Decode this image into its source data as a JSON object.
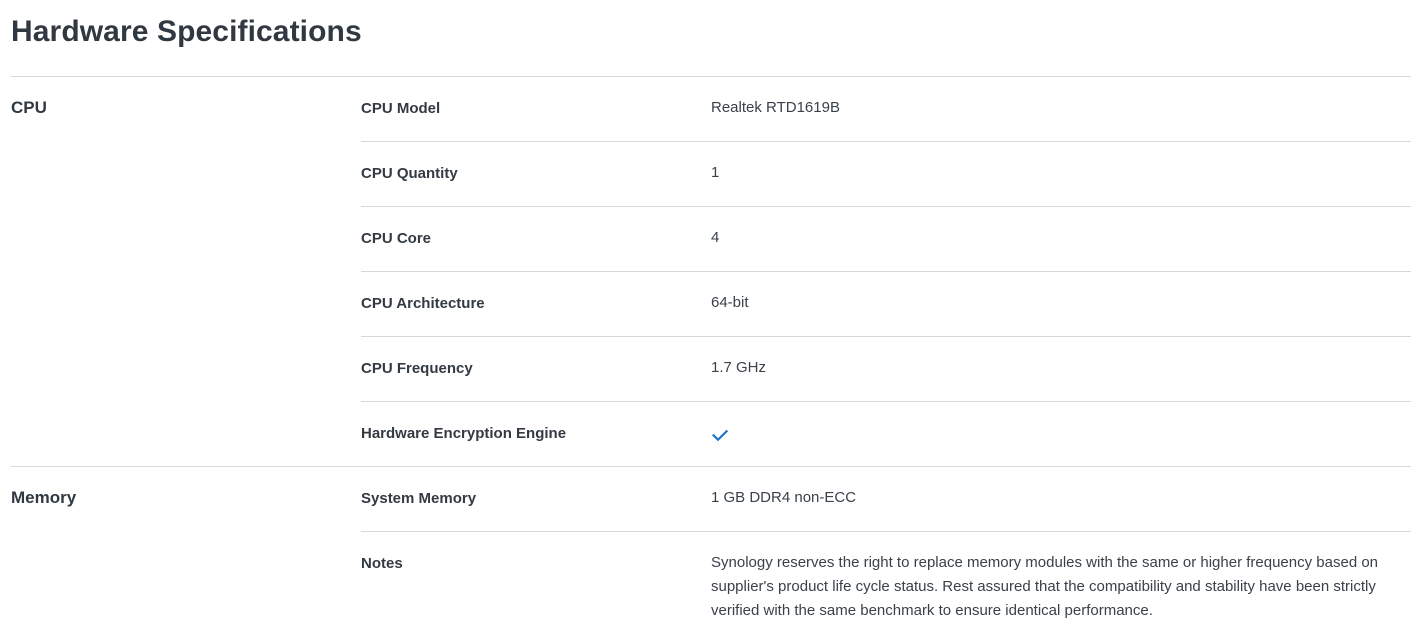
{
  "page": {
    "title": "Hardware Specifications"
  },
  "sections": {
    "cpu": {
      "name": "CPU",
      "rows": [
        {
          "label": "CPU Model",
          "value": "Realtek RTD1619B"
        },
        {
          "label": "CPU Quantity",
          "value": "1"
        },
        {
          "label": "CPU Core",
          "value": "4"
        },
        {
          "label": "CPU Architecture",
          "value": "64-bit"
        },
        {
          "label": "CPU Frequency",
          "value": "1.7 GHz"
        },
        {
          "label": "Hardware Encryption Engine",
          "value_icon": "check-icon"
        }
      ]
    },
    "memory": {
      "name": "Memory",
      "rows": [
        {
          "label": "System Memory",
          "value": "1 GB DDR4 non-ECC"
        },
        {
          "label": "Notes",
          "value": "Synology reserves the right to replace memory modules with the same or higher frequency based on supplier's product life cycle status. Rest assured that the compatibility and stability have been strictly verified with the same benchmark to ensure identical performance."
        }
      ]
    }
  },
  "colors": {
    "text": "#333a42",
    "rule": "#d5d8dc",
    "check": "#1a73c7"
  }
}
